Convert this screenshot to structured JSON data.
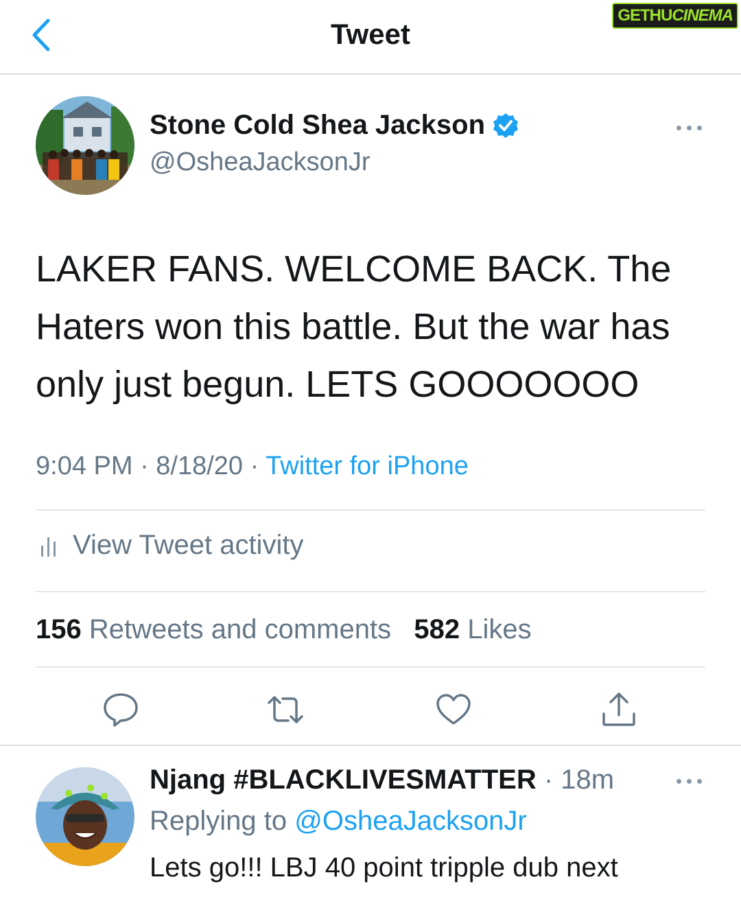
{
  "header": {
    "title": "Tweet",
    "back_icon": "chevron-left-icon"
  },
  "watermark": {
    "part1": "GETHU",
    "part2": "CINEMA"
  },
  "tweet": {
    "author_name": "Stone Cold Shea Jackson",
    "verified": true,
    "handle": "@OsheaJacksonJr",
    "text": "LAKER FANS. WELCOME BACK. The Haters won this battle. But the war has only just begun. LETS GOOOOOOO",
    "time_date": "9:04 PM · 8/18/20 · ",
    "source": "Twitter for iPhone",
    "activity_label": "View Tweet activity",
    "retweets_count": "156",
    "retweets_label": "Retweets and comments",
    "likes_count": "582",
    "likes_label": "Likes"
  },
  "reply": {
    "author_name": "Njang #BLACKLIVESMATTER",
    "time": "· 18m",
    "replying_prefix": "Replying to ",
    "replying_handle": "@OsheaJacksonJr",
    "text": "Lets go!!! LBJ 40 point tripple dub next"
  },
  "colors": {
    "accent": "#1da1f2",
    "secondary_text": "#657786",
    "primary_text": "#14171a",
    "divider": "#e1e8ed"
  }
}
